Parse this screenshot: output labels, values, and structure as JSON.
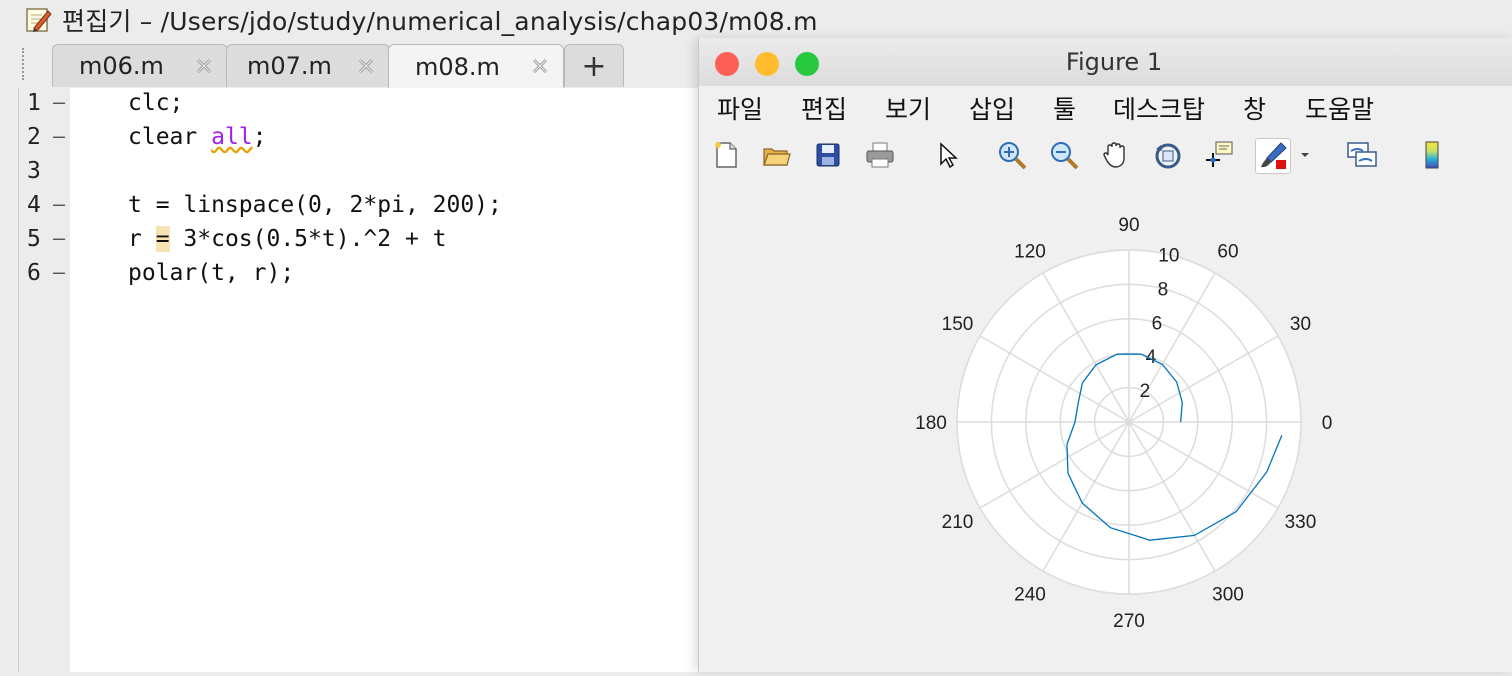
{
  "editor": {
    "title": "편집기 – /Users/jdo/study/numerical_analysis/chap03/m08.m",
    "tabs": [
      {
        "label": "m06.m"
      },
      {
        "label": "m07.m"
      },
      {
        "label": "m08.m"
      }
    ],
    "add_tab_label": "+",
    "lines": [
      {
        "num": "1",
        "marker": "–"
      },
      {
        "num": "2",
        "marker": "–"
      },
      {
        "num": "3",
        "marker": ""
      },
      {
        "num": "4",
        "marker": "–"
      },
      {
        "num": "5",
        "marker": "–"
      },
      {
        "num": "6",
        "marker": "–"
      }
    ],
    "code": {
      "l1": "clc;",
      "l2a": "clear ",
      "l2kw": "all",
      "l2b": ";",
      "l4": "t = linspace(0, 2*pi, 200);",
      "l5a": "r ",
      "l5op": "=",
      "l5b": " 3*cos(0.5*t).^2 + t",
      "l6": "polar(t, r);"
    }
  },
  "figure": {
    "title": "Figure 1",
    "menu": [
      "파일",
      "편집",
      "보기",
      "삽입",
      "툴",
      "데스크탑",
      "창",
      "도움말"
    ],
    "toolbar_icons": [
      "new-figure-icon",
      "open-file-icon",
      "save-icon",
      "print-icon",
      "pointer-icon",
      "zoom-in-icon",
      "zoom-out-icon",
      "pan-icon",
      "rotate-icon",
      "data-cursor-icon",
      "brush-icon",
      "link-icon",
      "colorbar-icon"
    ],
    "colors": {
      "close": "#fe5f57",
      "minimize": "#febc2e",
      "zoom": "#28c840",
      "line": "#0072bd"
    }
  },
  "chart_data": {
    "type": "line",
    "projection": "polar",
    "title": "",
    "angle_ticks": [
      "0",
      "30",
      "60",
      "90",
      "120",
      "150",
      "180",
      "210",
      "240",
      "270",
      "300",
      "330"
    ],
    "radius_ticks": [
      "2",
      "4",
      "6",
      "8",
      "10"
    ],
    "rlim": [
      0,
      10
    ],
    "grid": true,
    "series": [
      {
        "theta_deg": [
          0,
          20,
          40,
          60,
          80,
          100,
          120,
          140,
          160,
          180,
          200,
          220,
          240,
          260,
          280,
          300,
          320,
          340,
          355
        ],
        "r": [
          3.0,
          3.3,
          3.62,
          3.87,
          4.01,
          4.0,
          3.84,
          3.54,
          3.15,
          3.14,
          3.84,
          4.63,
          5.44,
          6.24,
          6.98,
          7.61,
          8.12,
          8.52,
          8.92
        ]
      }
    ]
  }
}
